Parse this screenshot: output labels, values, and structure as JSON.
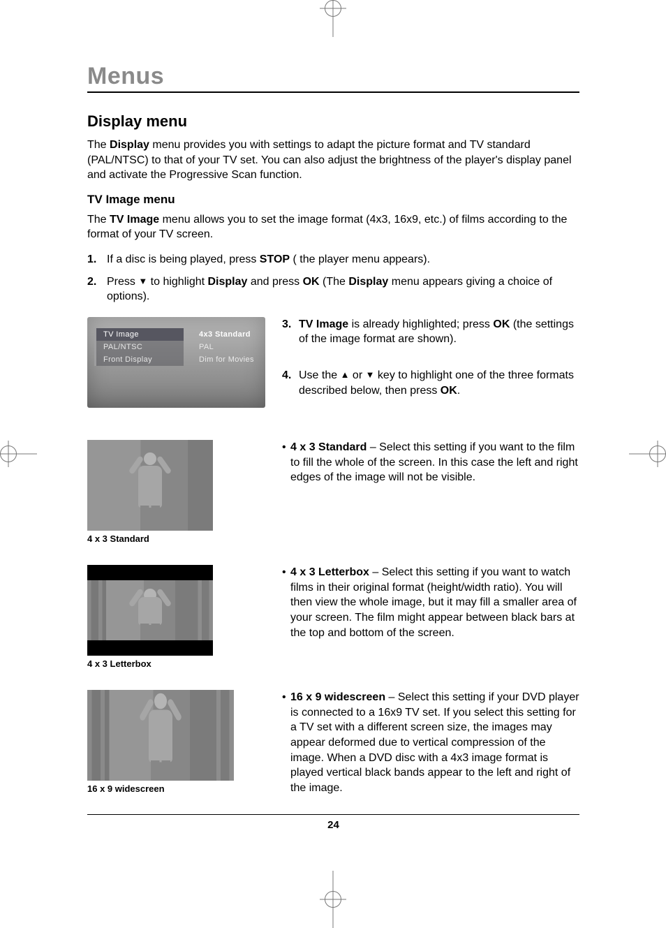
{
  "chapter_title": "Menus",
  "section_title": "Display menu",
  "intro_paragraph": {
    "pre": "The ",
    "bold": "Display",
    "post": " menu provides you with settings to adapt the picture format and TV standard (PAL/NTSC) to that of your TV set. You can also adjust the brightness of the player's display panel and activate the Progressive Scan function."
  },
  "subsection_title": "TV Image menu",
  "tv_image_intro": {
    "pre": "The ",
    "bold": "TV Image",
    "post": " menu allows you to set the image format (4x3, 16x9, etc.) of films according to the format of your TV screen."
  },
  "steps_main": [
    {
      "num": "1.",
      "parts": [
        "If a disc is being played, press ",
        "STOP",
        " ( the player menu appears)."
      ]
    },
    {
      "num": "2.",
      "parts": [
        "Press  ",
        "▼",
        "  to highlight ",
        "Display",
        " and press ",
        "OK",
        " (The ",
        "Display",
        " menu appears giving a choice of options)."
      ]
    }
  ],
  "menu_figure": {
    "left_items": [
      "TV Image",
      "PAL/NTSC",
      "Front Display"
    ],
    "right_values": [
      "4x3 Standard",
      "PAL",
      "Dim for Movies"
    ],
    "selected_index": 0
  },
  "steps_right": [
    {
      "num": "3.",
      "parts": [
        "TV Image",
        " is already highlighted; press ",
        "OK",
        " (the settings of the image format are shown)."
      ]
    },
    {
      "num": "4.",
      "parts": [
        "Use the  ",
        "▲",
        "  or  ",
        "▼",
        "  key to highlight one of the three formats described below, then press ",
        "OK",
        "."
      ]
    }
  ],
  "formats": [
    {
      "caption": "4 x 3 Standard",
      "label": "4 x 3 Standard",
      "text": " – Select this setting if you want to the film to fill the whole of the screen. In this case the left and right edges of the image will not be visible.",
      "thumb_class": "std"
    },
    {
      "caption": "4 x 3 Letterbox",
      "label": "4 x 3 Letterbox",
      "text": " – Select this setting if you want to watch films in their original format (height/width ratio). You will then view the whole image, but it may fill a smaller area of your screen. The film might appear between black bars at the top and bottom of the screen.",
      "thumb_class": "lbox"
    },
    {
      "caption": "16 x 9 widescreen",
      "label": "16 x 9 widescreen",
      "text": " – Select this setting if your DVD player is connected to a 16x9 TV set. If you select this setting for a TV set with a different screen size, the images may appear deformed due to vertical compression of the image. When a DVD disc with a 4x3 image format is played vertical black bands appear to the left and right of the image.",
      "thumb_class": "wide"
    }
  ],
  "page_number": "24"
}
